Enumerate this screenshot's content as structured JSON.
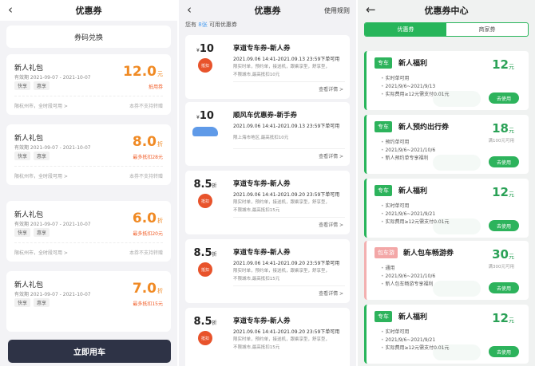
{
  "p1": {
    "title": "优惠券",
    "redeem": "券码兑换",
    "cards": [
      {
        "title": "新人礼包",
        "valid": "有效期 2021-09-07 - 2021-10-07",
        "tags": [
          "快享",
          "惠享"
        ],
        "amount": "12.0",
        "unit": "元",
        "sub": "抵用券",
        "city": "限杭州市，全时段可用 >",
        "transfer": "本券不支持转赠"
      },
      {
        "title": "新人礼包",
        "valid": "有效期 2021-09-07 - 2021-10-07",
        "tags": [
          "快享",
          "惠享"
        ],
        "amount": "8.0",
        "unit": "折",
        "sub": "最多抵扣28元",
        "city": "限杭州市，全时段可用 >",
        "transfer": "本券不支持转赠"
      },
      {
        "title": "新人礼包",
        "valid": "有效期 2021-09-07 - 2021-10-07",
        "tags": [
          "快享",
          "惠享"
        ],
        "amount": "6.0",
        "unit": "折",
        "sub": "最多抵扣20元",
        "city": "限杭州市，全时段可用 >",
        "transfer": "本券不支持转赠"
      },
      {
        "title": "新人礼包",
        "valid": "有效期 2021-09-07 - 2021-10-07",
        "tags": [
          "快享",
          "惠享"
        ],
        "amount": "7.0",
        "unit": "折",
        "sub": "最多抵扣15元",
        "city": "",
        "transfer": ""
      }
    ],
    "use_btn": "立即用车"
  },
  "p2": {
    "title": "优惠券",
    "rules": "使用规则",
    "count_pre": "您有",
    "count": "8张",
    "count_post": "可用优惠券",
    "cards": [
      {
        "amount": "10",
        "unit": "",
        "prefix": "¥",
        "badge": "抵扣",
        "title": "享道专车券-新人券",
        "date": "2021.09.06 14:41-2021.09.13 23:59下单可用",
        "scope": "限实时单，预约单，接送机，跟乘享型，舒享型，",
        "limit": "不限城市,最高抵扣10元",
        "detail": "查看详情 >"
      },
      {
        "amount": "10",
        "unit": "",
        "prefix": "¥",
        "badge": "",
        "title": "顺风车优惠券-新手券",
        "date": "2021.09.06 14:41-2021.09.13 23:59下单可用",
        "scope": "",
        "limit": "限上海市地区,最高抵扣10元",
        "detail": "查看详情 >"
      },
      {
        "amount": "8.5",
        "unit": "折",
        "prefix": "",
        "badge": "抵扣",
        "title": "享道专车券-新人券",
        "date": "2021.09.06 14:41-2021.09.20 23:59下单可用",
        "scope": "限实时单，预约单，接送机，跟乘享型，舒享型，",
        "limit": "不限城市,最高抵扣15元",
        "detail": "查看详情 >"
      },
      {
        "amount": "8.5",
        "unit": "折",
        "prefix": "",
        "badge": "抵扣",
        "title": "享道专车券-新人券",
        "date": "2021.09.06 14:41-2021.09.20 23:59下单可用",
        "scope": "限实时单，预约单，接送机，跟乘享型，舒享型，",
        "limit": "不限城市,最高抵扣15元",
        "detail": "查看详情 >"
      },
      {
        "amount": "8.5",
        "unit": "折",
        "prefix": "",
        "badge": "抵扣",
        "title": "享道专车券-新人券",
        "date": "2021.09.06 14:41-2021.09.20 23:59下单可用",
        "scope": "限实时单，预约单，接送机，跟乘享型，舒享型，",
        "limit": "不限城市,最高抵扣15元",
        "detail": ""
      }
    ]
  },
  "p3": {
    "title": "优惠券中心",
    "tabs": [
      "优惠券",
      "商家券"
    ],
    "cards": [
      {
        "label": "专车",
        "title": "新人福利",
        "amount": "12",
        "unit": "元",
        "min": "",
        "rows": [
          "实时单可用",
          "2021/9/6~2021/9/13",
          "实际费用≥12元需支付0.01元"
        ],
        "btn": "去使用",
        "pink": false
      },
      {
        "label": "专车",
        "title": "新人预约出行券",
        "amount": "18",
        "unit": "元",
        "min": "满100元可用",
        "rows": [
          "预约单可用",
          "2021/9/6~2021/10/6",
          "新人预约单专享福利"
        ],
        "btn": "去使用",
        "pink": false
      },
      {
        "label": "专车",
        "title": "新人福利",
        "amount": "12",
        "unit": "元",
        "min": "",
        "rows": [
          "实时单可用",
          "2021/9/6~2021/9/21",
          "实际费用≥12元需支付0.01元"
        ],
        "btn": "去使用",
        "pink": false
      },
      {
        "label": "包车游",
        "title": "新人包车畅游券",
        "amount": "30",
        "unit": "元",
        "min": "满300元可用",
        "rows": [
          "通用",
          "2021/9/6~2021/10/6",
          "新人包车畅游专享福利"
        ],
        "btn": "去使用",
        "pink": true
      },
      {
        "label": "专车",
        "title": "新人福利",
        "amount": "12",
        "unit": "元",
        "min": "",
        "rows": [
          "实时单可用",
          "2021/9/6~2021/9/21",
          "实际费用≥12元需支付0.01元"
        ],
        "btn": "去使用",
        "pink": false
      }
    ]
  }
}
